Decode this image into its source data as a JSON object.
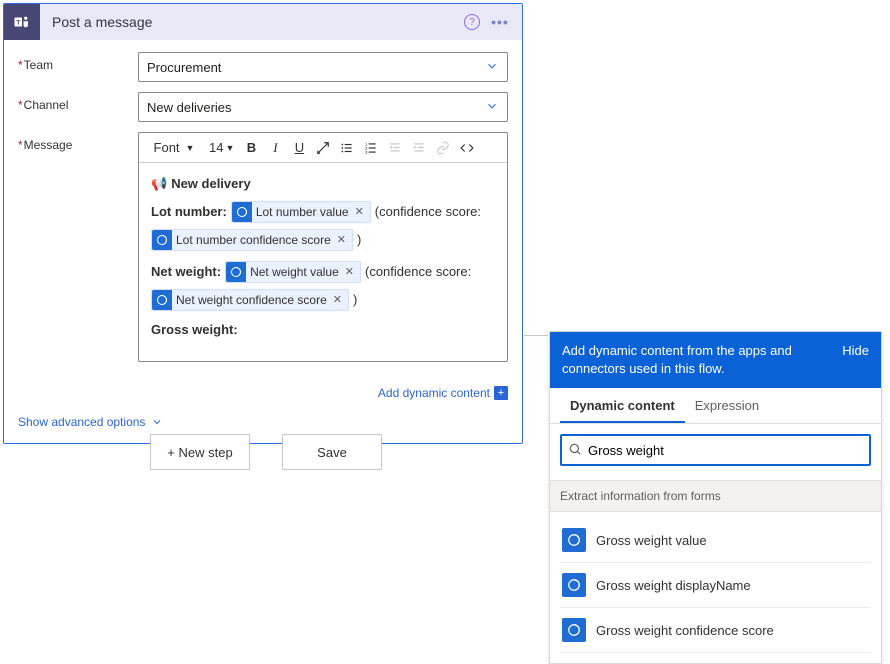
{
  "card": {
    "title": "Post a message",
    "app_icon": "teams-icon"
  },
  "form": {
    "team": {
      "label": "Team",
      "value": "Procurement"
    },
    "channel": {
      "label": "Channel",
      "value": "New deliveries"
    },
    "message": {
      "label": "Message"
    }
  },
  "editor": {
    "font": "Font",
    "size": "14",
    "heading_text": "New delivery",
    "line1_label": "Lot number:",
    "line1_token1": "Lot number value",
    "line1_trailing": "(confidence score:",
    "line1_token2": "Lot number confidence score",
    "line1_close": ")",
    "line2_label": "Net weight:",
    "line2_token1": "Net weight value",
    "line2_trailing": "(confidence score:",
    "line2_token2": "Net weight confidence score",
    "line2_close": ")",
    "line3_label": "Gross weight:"
  },
  "dynamic_link": "Add dynamic content",
  "advanced_link": "Show advanced options",
  "buttons": {
    "new_step": "+ New step",
    "save": "Save"
  },
  "panel": {
    "header": "Add dynamic content from the apps and connectors used in this flow.",
    "hide": "Hide",
    "tabs": {
      "dynamic": "Dynamic content",
      "expression": "Expression"
    },
    "search_value": "Gross weight",
    "section": "Extract information from forms",
    "results": [
      {
        "label": "Gross weight value"
      },
      {
        "label": "Gross weight displayName"
      },
      {
        "label": "Gross weight confidence score"
      }
    ]
  }
}
